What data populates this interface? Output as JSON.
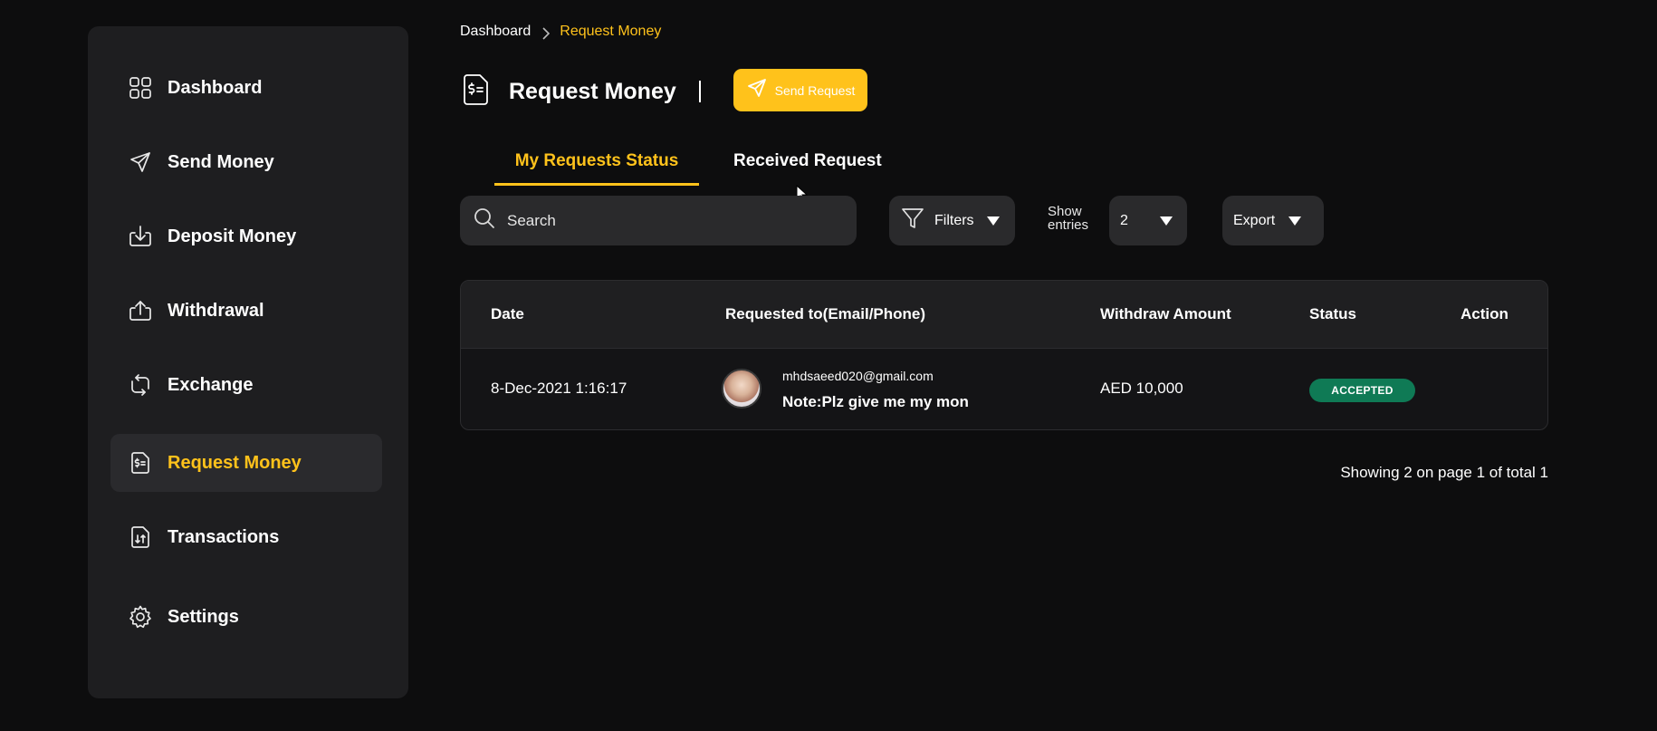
{
  "sidebar": {
    "items": [
      {
        "label": "Dashboard",
        "icon": "grid-icon"
      },
      {
        "label": "Send Money",
        "icon": "paper-plane-icon"
      },
      {
        "label": "Deposit Money",
        "icon": "download-tray-icon"
      },
      {
        "label": "Withdrawal",
        "icon": "upload-tray-icon"
      },
      {
        "label": "Exchange",
        "icon": "exchange-arrows-icon"
      },
      {
        "label": "Request Money",
        "icon": "dollar-document-icon",
        "active": true
      },
      {
        "label": "Transactions",
        "icon": "transfer-document-icon"
      },
      {
        "label": "Settings",
        "icon": "gear-icon"
      }
    ]
  },
  "breadcrumb": {
    "root": "Dashboard",
    "current": "Request Money"
  },
  "header": {
    "title": "Request Money",
    "send_button": "Send Request"
  },
  "tabs": [
    {
      "label": "My Requests Status",
      "active": true
    },
    {
      "label": "Received Request",
      "active": false
    }
  ],
  "toolbar": {
    "search_placeholder": "Search",
    "filters_label": "Filters",
    "show_entries_line1": "Show",
    "show_entries_line2": "entries",
    "entries_value": "2",
    "export_label": "Export"
  },
  "table": {
    "headers": {
      "date": "Date",
      "requested_to": "Requested to(Email/Phone)",
      "amount": "Withdraw Amount",
      "status": "Status",
      "action": "Action"
    },
    "rows": [
      {
        "date": "8-Dec-2021 1:16:17",
        "email": "mhdsaeed020@gmail.com",
        "note": "Note:Plz give me my mon",
        "amount": "AED 10,000",
        "status": "ACCEPTED"
      }
    ]
  },
  "pagination": {
    "info": "Showing 2 on page 1 of total 1"
  },
  "colors": {
    "accent": "#ffc21b",
    "background": "#0d0d0e",
    "panel": "#1e1e20",
    "status_accepted": "#0f7a55"
  }
}
